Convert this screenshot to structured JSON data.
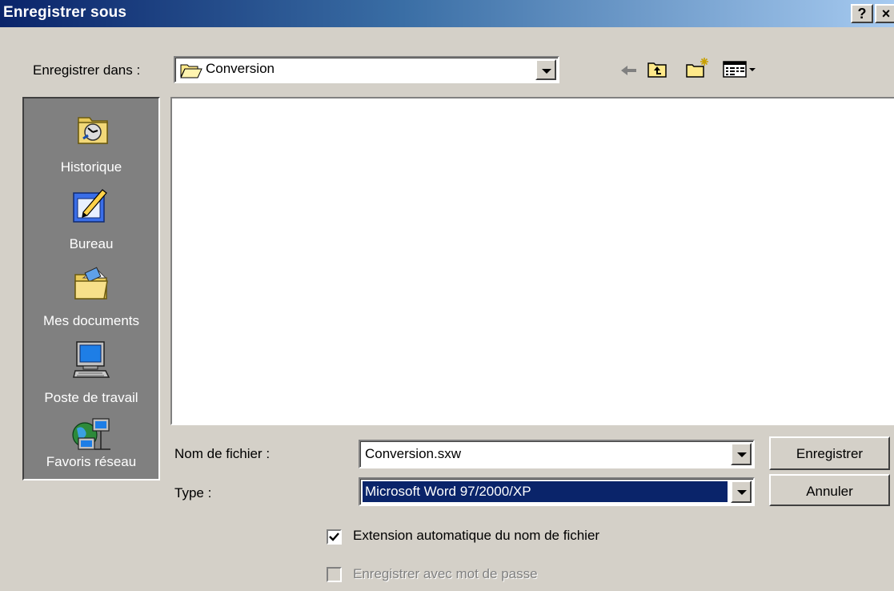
{
  "window": {
    "title": "Enregistrer sous",
    "help_label": "?",
    "close_label": "×"
  },
  "save_in": {
    "label": "Enregistrer dans :",
    "value": "Conversion",
    "icon": "folder-open-icon"
  },
  "toolbar": {
    "icons": [
      "back-arrow-icon",
      "up-one-level-icon",
      "new-folder-icon",
      "view-menu-icon"
    ]
  },
  "places": [
    {
      "label": "Historique",
      "icon": "history-icon"
    },
    {
      "label": "Bureau",
      "icon": "desktop-icon"
    },
    {
      "label": "Mes documents",
      "icon": "my-documents-icon"
    },
    {
      "label": "Poste de travail",
      "icon": "my-computer-icon"
    },
    {
      "label": "Favoris réseau",
      "icon": "network-places-icon"
    }
  ],
  "file_name": {
    "label": "Nom de fichier :",
    "value": "Conversion.sxw"
  },
  "file_type": {
    "label": "Type :",
    "value": "Microsoft Word 97/2000/XP"
  },
  "buttons": {
    "save": "Enregistrer",
    "cancel": "Annuler"
  },
  "options": {
    "auto_extension": {
      "label": "Extension automatique du nom de fichier",
      "checked": true
    },
    "password": {
      "label": "Enregistrer avec mot de passe",
      "checked": false,
      "disabled": true
    }
  },
  "colors": {
    "titlebar_start": "#0a246a",
    "titlebar_end": "#a6caf0",
    "selection": "#0a246a",
    "dialog_bg": "#d4d0c8"
  }
}
